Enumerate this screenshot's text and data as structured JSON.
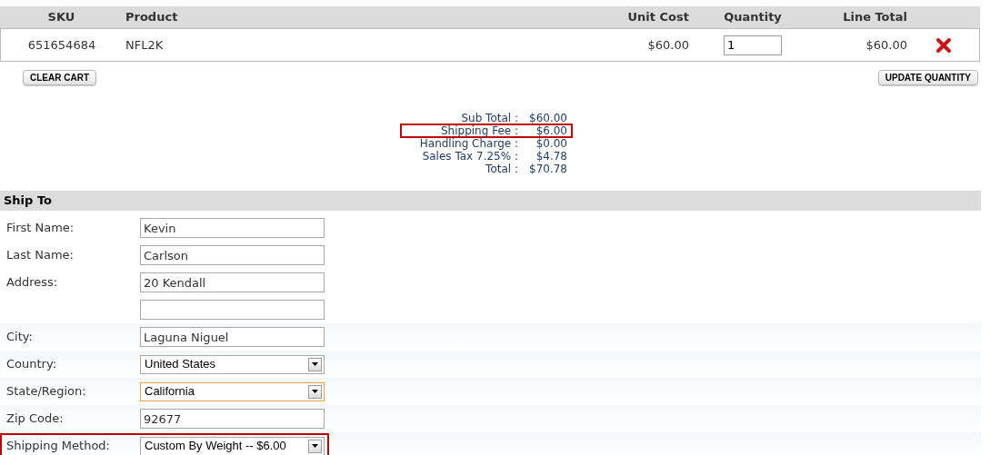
{
  "cart": {
    "columns": [
      "SKU",
      "Product",
      "Unit Cost",
      "Quantity",
      "Line Total"
    ],
    "rows": [
      {
        "sku": "651654684",
        "product": "NFL2K",
        "unit_cost": "$60.00",
        "quantity": "1",
        "line_total": "$60.00"
      }
    ],
    "buttons": [
      "CLEAR CART",
      "UPDATE QUANTITY"
    ]
  },
  "summary": [
    {
      "label": "Sub Total :",
      "value": "$60.00",
      "highlighted": false
    },
    {
      "label": "Shipping Fee :",
      "value": "$6.00",
      "highlighted": true
    },
    {
      "label": "Handling Charge :",
      "value": "$0.00",
      "highlighted": false
    },
    {
      "label": "Sales Tax 7.25% :",
      "value": "$4.78",
      "highlighted": false
    },
    {
      "label": "Total :",
      "value": "$70.78",
      "highlighted": false
    }
  ],
  "ship_to": {
    "title": "Ship To",
    "fields": [
      {
        "kind": "text",
        "label": "First Name:",
        "value": "Kevin",
        "focused": false,
        "highlighted": false
      },
      {
        "kind": "text",
        "label": "Last Name:",
        "value": "Carlson",
        "focused": false,
        "highlighted": false
      },
      {
        "kind": "text",
        "label": "Address:",
        "value": "20 Kendall",
        "focused": false,
        "highlighted": false
      },
      {
        "kind": "text",
        "focused": false,
        "highlighted": false
      },
      {
        "kind": "text",
        "label": "City:",
        "value": "Laguna Niguel",
        "focused": false,
        "highlighted": false
      },
      {
        "kind": "select",
        "label": "Country:",
        "value": "United States",
        "focused": false,
        "highlighted": false
      },
      {
        "kind": "select",
        "label": "State/Region:",
        "value": "California",
        "focused": true,
        "highlighted": false
      },
      {
        "kind": "text",
        "label": "Zip Code:",
        "value": "92677",
        "focused": false,
        "highlighted": false
      },
      {
        "kind": "select",
        "label": "Shipping Method:",
        "value": "Custom By Weight -- $6.00",
        "focused": false,
        "highlighted": true
      }
    ]
  }
}
